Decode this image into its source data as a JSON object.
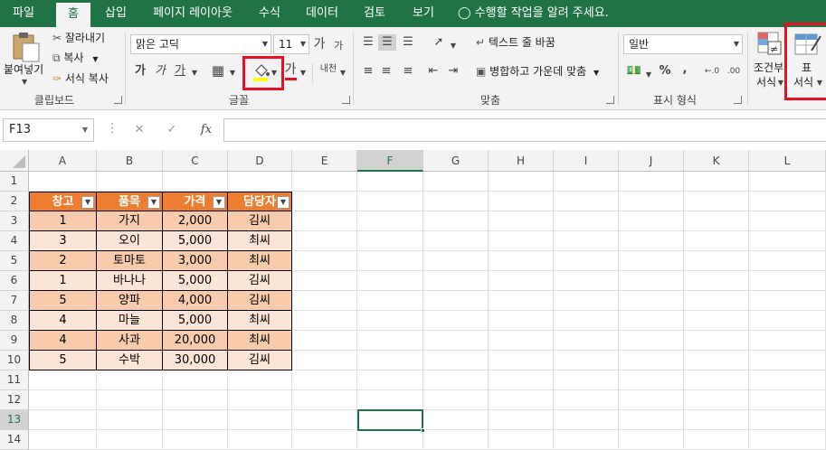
{
  "tabs": [
    "파일",
    "홈",
    "삽입",
    "페이지 레이아웃",
    "수식",
    "데이터",
    "검토",
    "보기"
  ],
  "tell_me": "수행할 작업을 알려 주세요.",
  "clipboard": {
    "paste": "붙여넣기",
    "cut": "잘라내기",
    "copy": "복사",
    "format_painter": "서식 복사",
    "group_label": "클립보드"
  },
  "font": {
    "name": "맑은 고딕",
    "size": "11",
    "grow": "가",
    "shrink": "가",
    "bold": "가",
    "italic": "가",
    "underline": "가",
    "font_color_glyph": "가",
    "phonetic": "내천",
    "group_label": "글꼴",
    "fill_color": "#ffff00",
    "font_color": "#e81123"
  },
  "alignment": {
    "wrap_text": "텍스트 줄 바꿈",
    "merge_center": "병합하고 가운데 맞춤",
    "group_label": "맞춤"
  },
  "number": {
    "format": "일반",
    "percent": "%",
    "comma": ",",
    "inc_decimal": "←.0",
    "dec_decimal": ".00",
    "group_label": "표시 형식"
  },
  "styles": {
    "conditional_1": "조건부",
    "conditional_2": "서식",
    "table_1": "표",
    "table_2": "서식"
  },
  "name_box": "F13",
  "fx": "fx",
  "columns": [
    "A",
    "B",
    "C",
    "D",
    "E",
    "F",
    "G",
    "H",
    "I",
    "J",
    "K",
    "L"
  ],
  "rows": [
    "1",
    "2",
    "3",
    "4",
    "5",
    "6",
    "7",
    "8",
    "9",
    "10",
    "11",
    "12",
    "13",
    "14"
  ],
  "selected_column": "F",
  "selected_row": "13",
  "table": {
    "headers": [
      "창고",
      "품목",
      "가격",
      "담당자"
    ],
    "rows": [
      [
        "1",
        "가지",
        "2,000",
        "김씨"
      ],
      [
        "3",
        "오이",
        "5,000",
        "최씨"
      ],
      [
        "2",
        "토마토",
        "3,000",
        "최씨"
      ],
      [
        "1",
        "바나나",
        "5,000",
        "김씨"
      ],
      [
        "5",
        "양파",
        "4,000",
        "김씨"
      ],
      [
        "4",
        "마늘",
        "5,000",
        "최씨"
      ],
      [
        "4",
        "사과",
        "20,000",
        "최씨"
      ],
      [
        "5",
        "수박",
        "30,000",
        "김씨"
      ]
    ],
    "header_color": "#ed7d31",
    "band1_color": "#f8cbad",
    "band2_color": "#fce4d6"
  },
  "accent": "#217346",
  "highlight": "#e81123"
}
